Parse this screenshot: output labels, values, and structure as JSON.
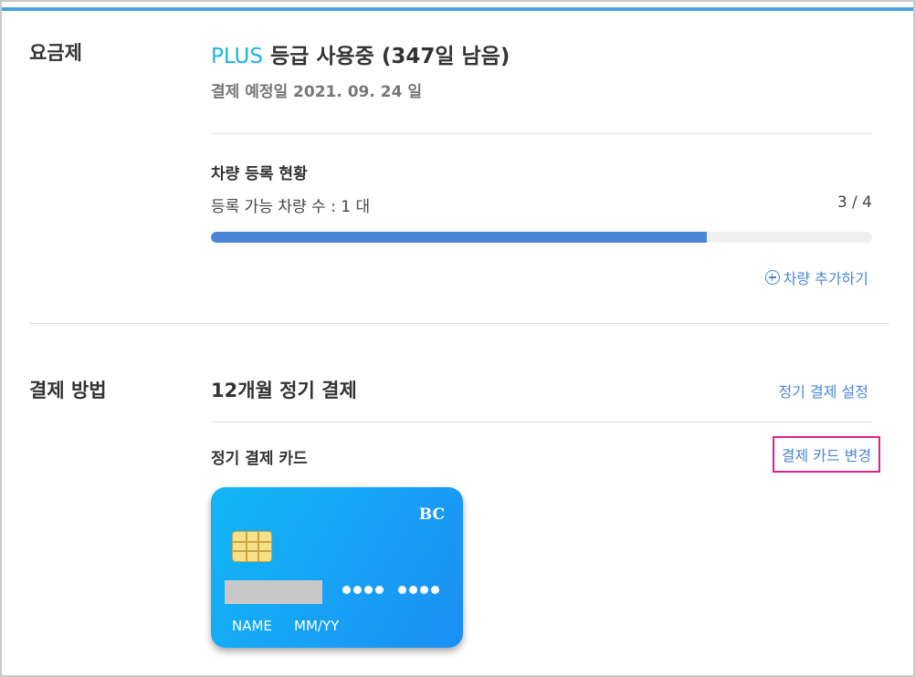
{
  "plan": {
    "section_label": "요금제",
    "tier": "PLUS",
    "status": "등급 사용중 (347일 남음)",
    "billing_date": "결제 예정일 2021. 09. 24 일"
  },
  "vehicles": {
    "heading": "차량 등록 현황",
    "available_label": "등록 가능 차량 수 : 1 대",
    "count": "3 / 4",
    "progress_fraction": 0.75,
    "add_link": "차량 추가하기"
  },
  "payment": {
    "section_label": "결제 방법",
    "title": "12개월 정기 결제",
    "settings_link": "정기 결제 설정",
    "card_heading": "정기 결제 카드",
    "change_card_link": "결제 카드 변경"
  },
  "card": {
    "issuer": "BC",
    "name": "NAME",
    "expiry": "MM/YY"
  },
  "colors": {
    "accent_blue": "#4a86d8",
    "plus_cyan": "#1bb3e6",
    "highlight_magenta": "#e0208a"
  }
}
